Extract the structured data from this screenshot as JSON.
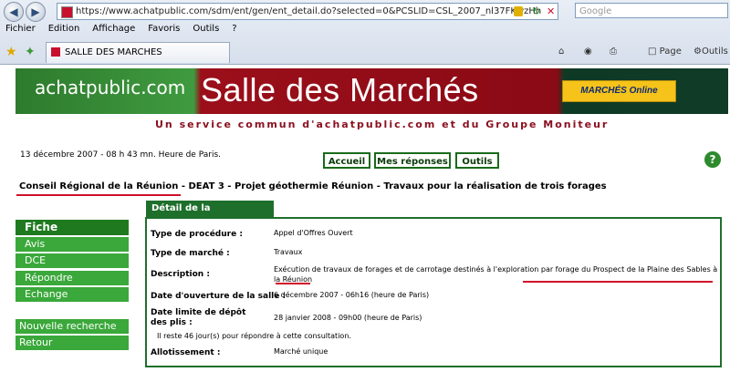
{
  "browser": {
    "url": "https://www.achatpublic.com/sdm/ent/gen/ent_detail.do?selected=0&PCSLID=CSL_2007_nl37FKwzHh",
    "search_placeholder": "Google",
    "menu": [
      "Fichier",
      "Edition",
      "Affichage",
      "Favoris",
      "Outils",
      "?"
    ],
    "tab_title": "SALLE DES MARCHES",
    "toolbar_page": "Page",
    "toolbar_tools": "Outils"
  },
  "banner": {
    "logo_text": "achatpublic.com",
    "title": "Salle des Marchés",
    "badge": "MARCHÉS Online",
    "subtitle": "Un service commun d'achatpublic.com et du Groupe Moniteur"
  },
  "header": {
    "date": "13 décembre 2007 - 08 h 43 mn. Heure de Paris.",
    "buttons": [
      "Accueil",
      "Mes réponses",
      "Outils"
    ],
    "help": "?"
  },
  "breadcrumb": {
    "org": "Conseil Régional de la Réunion",
    "sep1": " - ",
    "dept": "DEAT 3",
    "sep2": " - ",
    "project": "Projet géothermie Réunion - Travaux pour la réalisation de trois forages"
  },
  "nav": {
    "items": [
      "Fiche consultation",
      "Avis",
      "DCE",
      "Répondre",
      "Echange"
    ],
    "secondary": [
      "Nouvelle recherche",
      "Retour"
    ]
  },
  "detail": {
    "heading": "Détail de la Consultation",
    "rows": [
      {
        "label": "Type de procédure :",
        "value": "Appel d'Offres Ouvert"
      },
      {
        "label": "Type de marché :",
        "value": "Travaux"
      },
      {
        "label": "Description :",
        "value": "Exécution de travaux de forages et de carrotage destinés à l'exploration par forage du Prospect de la Plaine des Sables à la Réunion"
      },
      {
        "label": "Date d'ouverture de la salle :",
        "value": "6 décembre 2007 - 06h16 (heure de Paris)"
      },
      {
        "label": "Date limite de dépôt des plis :",
        "value": "28 janvier 2008 - 09h00 (heure de Paris)"
      },
      {
        "label": "Allotissement :",
        "value": "Marché unique"
      }
    ],
    "remaining": "Il reste 46 jour(s) pour répondre à cette consultation."
  },
  "colors": {
    "green": "#1f6f2c",
    "red": "#d0102a",
    "brand_red": "#9b0f1a"
  }
}
